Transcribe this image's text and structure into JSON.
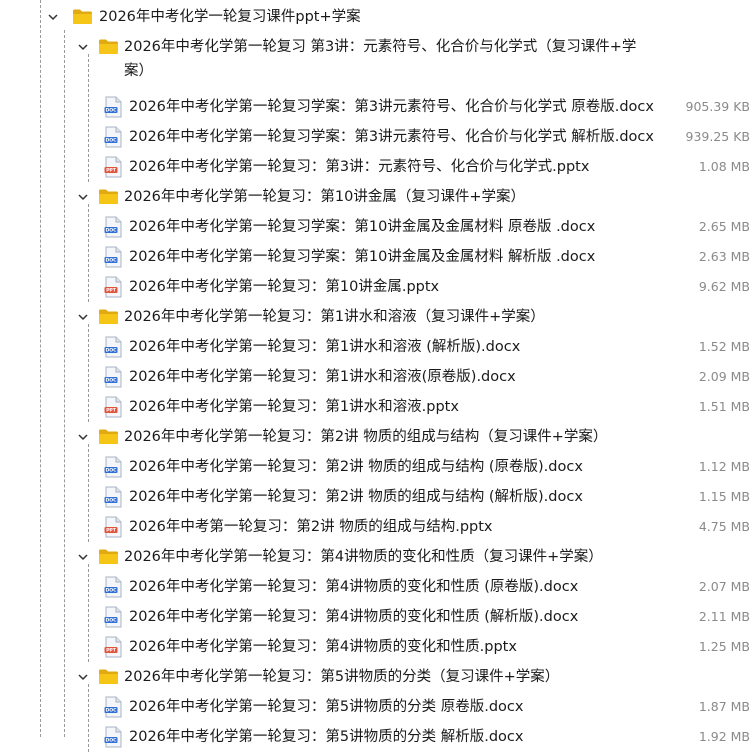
{
  "root": {
    "name": "2026年中考化学一轮复习课件ppt+学案"
  },
  "groups": [
    {
      "name_line1": "2026年中考化学第一轮复习 第3讲：元素符号、化合价与化学式（复习课件+学",
      "name_line2": "案）",
      "files": [
        {
          "type": "doc",
          "name": "2026年中考化学第一轮复习学案：第3讲元素符号、化合价与化学式 原卷版.docx",
          "size": "905.39 KB"
        },
        {
          "type": "doc",
          "name": "2026年中考化学第一轮复习学案：第3讲元素符号、化合价与化学式 解析版.docx",
          "size": "939.25 KB"
        },
        {
          "type": "ppt",
          "name": "2026年中考化学第一轮复习：第3讲：元素符号、化合价与化学式.pptx",
          "size": "1.08 MB"
        }
      ]
    },
    {
      "name_line1": "2026年中考化学第一轮复习：第10讲金属（复习课件+学案）",
      "name_line2": "",
      "files": [
        {
          "type": "doc",
          "name": "2026年中考化学第一轮复习学案：第10讲金属及金属材料 原卷版 .docx",
          "size": "2.65 MB"
        },
        {
          "type": "doc",
          "name": "2026年中考化学第一轮复习学案：第10讲金属及金属材料 解析版 .docx",
          "size": "2.63 MB"
        },
        {
          "type": "ppt",
          "name": "2026年中考化学第一轮复习：第10讲金属.pptx",
          "size": "9.62 MB"
        }
      ]
    },
    {
      "name_line1": "2026年中考化学第一轮复习：第1讲水和溶液（复习课件+学案）",
      "name_line2": "",
      "files": [
        {
          "type": "doc",
          "name": "2026年中考化学第一轮复习：第1讲水和溶液 (解析版).docx",
          "size": "1.52 MB"
        },
        {
          "type": "doc",
          "name": "2026年中考化学第一轮复习：第1讲水和溶液(原卷版).docx",
          "size": "2.09 MB"
        },
        {
          "type": "ppt",
          "name": "2026年中考化学第一轮复习：第1讲水和溶液.pptx",
          "size": "1.51 MB"
        }
      ]
    },
    {
      "name_line1": "2026年中考化学第一轮复习：第2讲 物质的组成与结构（复习课件+学案）",
      "name_line2": "",
      "files": [
        {
          "type": "doc",
          "name": "2026年中考化学第一轮复习：第2讲 物质的组成与结构 (原卷版).docx",
          "size": "1.12 MB"
        },
        {
          "type": "doc",
          "name": "2026年中考化学第一轮复习：第2讲 物质的组成与结构 (解析版).docx",
          "size": "1.15 MB"
        },
        {
          "type": "ppt",
          "name": "2026年中考第一轮复习：第2讲 物质的组成与结构.pptx",
          "size": "4.75 MB"
        }
      ]
    },
    {
      "name_line1": "2026年中考化学第一轮复习：第4讲物质的变化和性质（复习课件+学案）",
      "name_line2": "",
      "files": [
        {
          "type": "doc",
          "name": "2026年中考化学第一轮复习：第4讲物质的变化和性质 (原卷版).docx",
          "size": "2.07 MB"
        },
        {
          "type": "doc",
          "name": "2026年中考化学第一轮复习：第4讲物质的变化和性质 (解析版).docx",
          "size": "2.11 MB"
        },
        {
          "type": "ppt",
          "name": "2026年中考化学第一轮复习：第4讲物质的变化和性质.pptx",
          "size": "1.25 MB"
        }
      ]
    },
    {
      "name_line1": "2026年中考化学第一轮复习：第5讲物质的分类（复习课件+学案）",
      "name_line2": "",
      "files": [
        {
          "type": "doc",
          "name": "2026年中考化学第一轮复习：第5讲物质的分类 原卷版.docx",
          "size": "1.87 MB"
        },
        {
          "type": "doc",
          "name": "2026年中考化学第一轮复习：第5讲物质的分类 解析版.docx",
          "size": "1.92 MB"
        }
      ]
    }
  ],
  "icons": {
    "doc_label": "DOC",
    "ppt_label": "PPT"
  },
  "colors": {
    "folder": "#f5c518",
    "folder_dark": "#e0aa10",
    "doc_badge": "#2f6fd6",
    "ppt_badge": "#e0533b"
  }
}
